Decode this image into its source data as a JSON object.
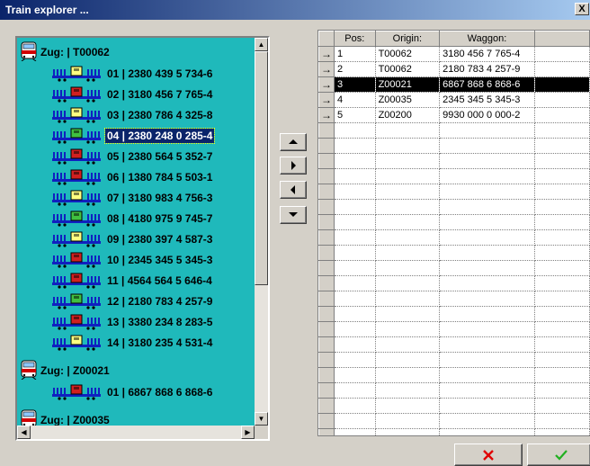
{
  "window": {
    "title": "Train explorer ...",
    "close_glyph": "X"
  },
  "tree": {
    "trains": [
      {
        "label": "Zug: | T00062",
        "wagons": [
          {
            "label": "01 | 2380 439 5 734-6",
            "color": "#ffff80"
          },
          {
            "label": "02 | 3180 456 7 765-4",
            "color": "#d02020"
          },
          {
            "label": "03 | 2380 786 4 325-8",
            "color": "#ffff80"
          },
          {
            "label": "04 | 2380 248 0 285-4",
            "color": "#40c040",
            "selected": true
          },
          {
            "label": "05 | 2380 564 5 352-7",
            "color": "#d02020"
          },
          {
            "label": "06 | 1380 784 5 503-1",
            "color": "#d02020"
          },
          {
            "label": "07 | 3180 983 4 756-3",
            "color": "#ffff80"
          },
          {
            "label": "08 | 4180 975 9 745-7",
            "color": "#40c040"
          },
          {
            "label": "09 | 2380 397 4 587-3",
            "color": "#ffff80"
          },
          {
            "label": "10 | 2345 345 5 345-3",
            "color": "#d02020"
          },
          {
            "label": "11 | 4564 564 5 646-4",
            "color": "#d02020"
          },
          {
            "label": "12 | 2180 783 4 257-9",
            "color": "#40c040"
          },
          {
            "label": "13 | 3380 234 8 283-5",
            "color": "#d02020"
          },
          {
            "label": "14 | 3180 235 4 531-4",
            "color": "#ffff80"
          }
        ]
      },
      {
        "label": "Zug: | Z00021",
        "wagons": [
          {
            "label": "01 | 6867 868 6 868-6",
            "color": "#d02020"
          }
        ]
      },
      {
        "label": "Zug: | Z00035",
        "wagons": []
      }
    ]
  },
  "grid": {
    "columns": [
      "Pos:",
      "Origin:",
      "Waggon:",
      ""
    ],
    "rows": [
      {
        "pos": "1",
        "origin": "T00062",
        "waggon": "3180 456 7 765-4"
      },
      {
        "pos": "2",
        "origin": "T00062",
        "waggon": "2180 783 4 257-9"
      },
      {
        "pos": "3",
        "origin": "Z00021",
        "waggon": "6867 868 6 868-6",
        "selected": true
      },
      {
        "pos": "4",
        "origin": "Z00035",
        "waggon": "2345 345 5 345-3"
      },
      {
        "pos": "5",
        "origin": "Z00200",
        "waggon": "9930 000 0 000-2"
      }
    ],
    "row_indicator": "→",
    "total_rows": 26
  },
  "colors": {
    "tree_bg": "#1fb9bb",
    "wagon_blue": "#1020c0",
    "cancel_red": "#e00000",
    "ok_green": "#20b020"
  },
  "icons": {
    "move_up": "up-arrow-icon",
    "move_right": "right-arrow-icon",
    "move_left": "left-arrow-icon",
    "move_down": "down-arrow-icon",
    "cancel": "cross-icon",
    "ok": "check-icon"
  }
}
